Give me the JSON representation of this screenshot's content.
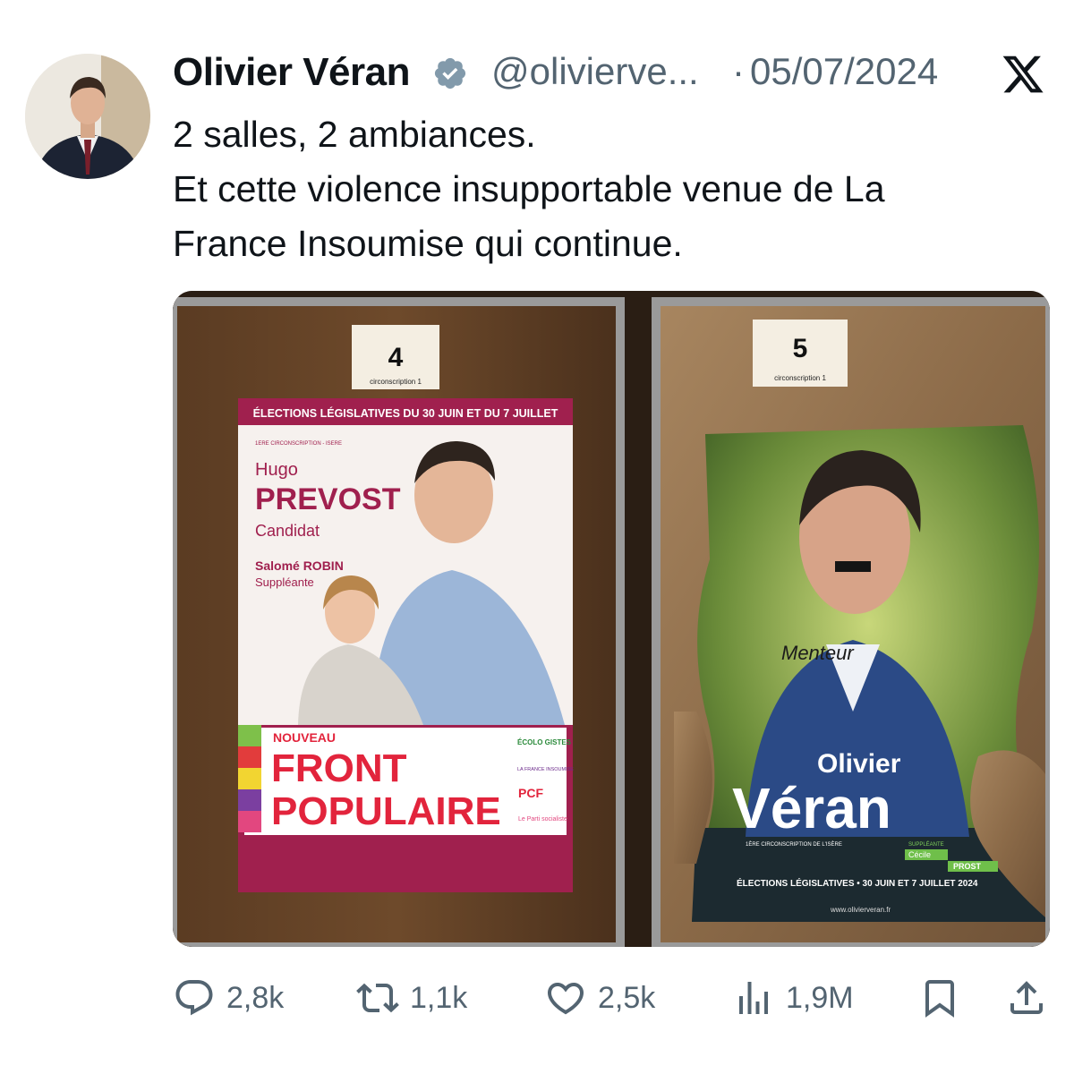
{
  "tweet": {
    "author_name": "Olivier Véran",
    "handle": "@olivierve...",
    "separator": "·",
    "date": "05/07/2024",
    "text_lines": [
      "2 salles, 2 ambiances.",
      "Et cette violence insupportable venue de La",
      "France Insoumise qui continue."
    ]
  },
  "media": {
    "left_panel": {
      "number": "4",
      "circonscription": "circonscription 1",
      "banner": "ÉLECTIONS LÉGISLATIVES DU 30 JUIN ET DU 7 JUILLET",
      "sub": "1ERE CIRCONSCRIPTION - ISERE",
      "first_name": "Hugo",
      "last_name": "PREVOST",
      "role": "Candidat",
      "substitute_name": "Salomé ROBIN",
      "substitute_role": "Suppléante",
      "nouveau": "NOUVEAU",
      "front": "FRONT",
      "populaire": "POPULAIRE",
      "logo_ecolo": "ÉCOLO GISTES",
      "logo_lfi": "LA FRANCE INSOUMISE",
      "logo_pcf": "PCF",
      "logo_ps": "Le Parti socialiste"
    },
    "right_panel": {
      "number": "5",
      "circonscription": "circonscription 1",
      "first_name": "Olivier",
      "last_name": "Véran",
      "graffiti": "Menteur",
      "circ_line": "1ÈRE CIRCONSCRIPTION DE L'ISÈRE",
      "suppleante": "SUPPLÉANTE",
      "cecile": "Cécile",
      "prost": "PROST",
      "elections": "ÉLECTIONS LÉGISLATIVES • 30 JUIN ET 7 JUILLET 2024",
      "website": "www.olivierveran.fr"
    }
  },
  "actions": {
    "replies": "2,8k",
    "reposts": "1,1k",
    "likes": "2,5k",
    "views": "1,9M"
  },
  "colors": {
    "text": "#0f1419",
    "secondary": "#536471",
    "verified": "#829aab"
  },
  "icons": [
    "verified-badge-icon",
    "x-logo-icon",
    "reply-icon",
    "repost-icon",
    "like-icon",
    "views-icon",
    "bookmark-icon",
    "share-icon"
  ]
}
